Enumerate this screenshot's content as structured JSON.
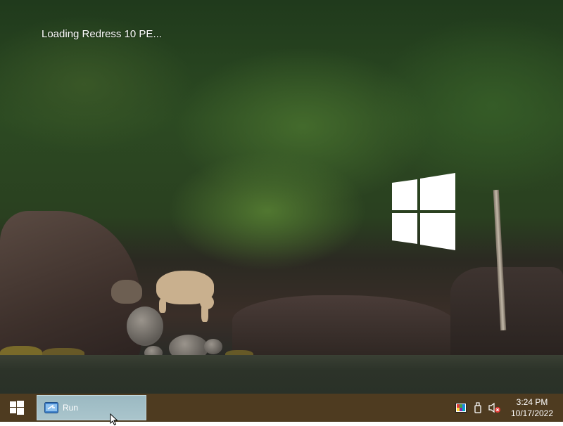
{
  "desktop": {
    "loading_text": "Loading Redress 10 PE..."
  },
  "taskbar": {
    "start_icon": "windows-start-icon",
    "running_tasks": [
      {
        "label": "Run",
        "icon": "run-dialog-icon",
        "active": true
      }
    ],
    "tray": {
      "icons": [
        "color-display-icon",
        "usb-drive-icon",
        "speaker-muted-icon"
      ],
      "time": "3:24 PM",
      "date": "10/17/2022"
    }
  },
  "colors": {
    "taskbar_bg": "#4e3b20",
    "task_active_bg": "#a7c2c9",
    "logo": "#ffffff"
  }
}
